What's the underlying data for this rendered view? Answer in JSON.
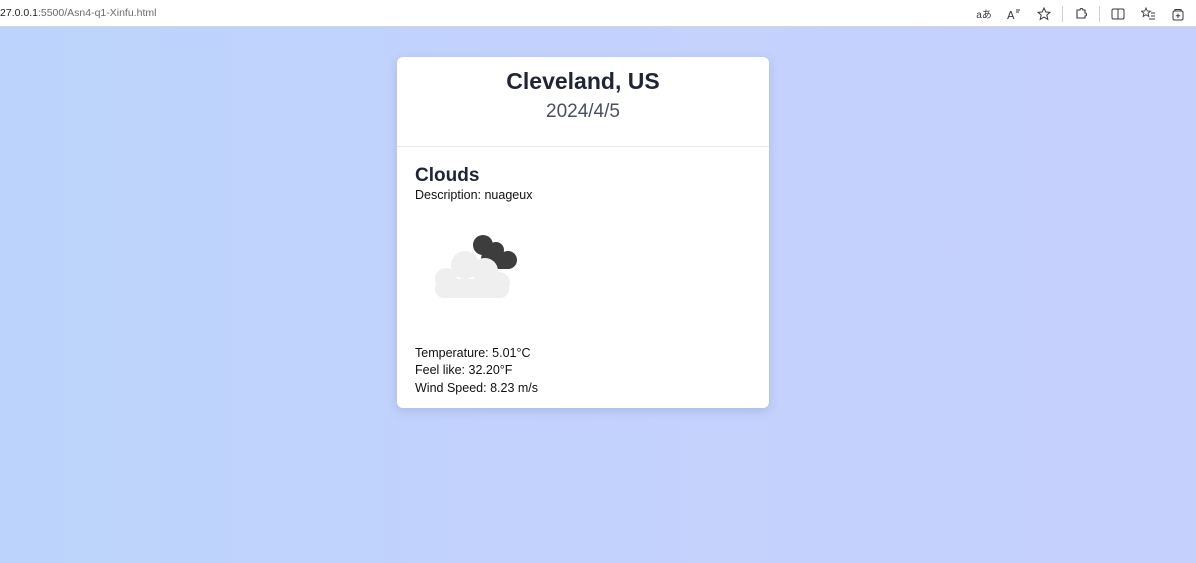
{
  "browser": {
    "url_host": "27.0.0.1",
    "url_rest": ":5500/Asn4-q1-Xinfu.html",
    "toolbar_read_aloud_label": "aあ"
  },
  "weather": {
    "city": "Cleveland, US",
    "date": "2024/4/5",
    "condition": "Clouds",
    "description_label": "Description:",
    "description_value": "nuageux",
    "temperature_label": "Temperature:",
    "temperature_value": "5.01°C",
    "feel_like_label": "Feel like:",
    "feel_like_value": "32.20°F",
    "wind_label": "Wind Speed:",
    "wind_value": "8.23 m/s",
    "icon": "broken-clouds-icon"
  },
  "colors": {
    "page_background": "#c3d2fc",
    "card_background": "#ffffff",
    "cloud_dark": "#3d3d3d",
    "cloud_light": "#efefef"
  }
}
